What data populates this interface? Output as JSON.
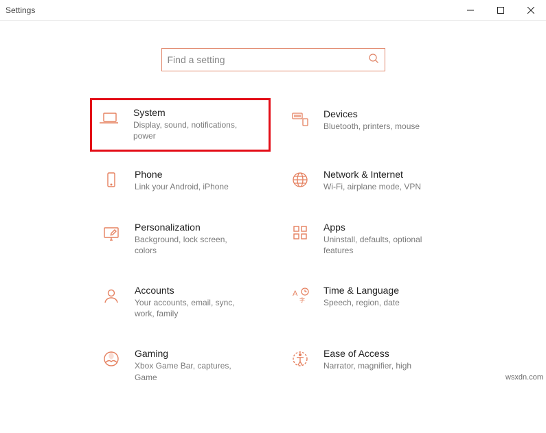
{
  "window": {
    "title": "Settings"
  },
  "search": {
    "placeholder": "Find a setting"
  },
  "tiles": [
    {
      "icon": "laptop",
      "title": "System",
      "desc": "Display, sound, notifications, power",
      "highlighted": true
    },
    {
      "icon": "devices",
      "title": "Devices",
      "desc": "Bluetooth, printers, mouse"
    },
    {
      "icon": "phone",
      "title": "Phone",
      "desc": "Link your Android, iPhone"
    },
    {
      "icon": "globe",
      "title": "Network & Internet",
      "desc": "Wi-Fi, airplane mode, VPN"
    },
    {
      "icon": "personal",
      "title": "Personalization",
      "desc": "Background, lock screen, colors"
    },
    {
      "icon": "apps",
      "title": "Apps",
      "desc": "Uninstall, defaults, optional features"
    },
    {
      "icon": "accounts",
      "title": "Accounts",
      "desc": "Your accounts, email, sync, work, family"
    },
    {
      "icon": "time",
      "title": "Time & Language",
      "desc": "Speech, region, date"
    },
    {
      "icon": "gaming",
      "title": "Gaming",
      "desc": "Xbox Game Bar, captures, Game"
    },
    {
      "icon": "ease",
      "title": "Ease of Access",
      "desc": "Narrator, magnifier, high"
    }
  ],
  "watermark": "wsxdn.com"
}
